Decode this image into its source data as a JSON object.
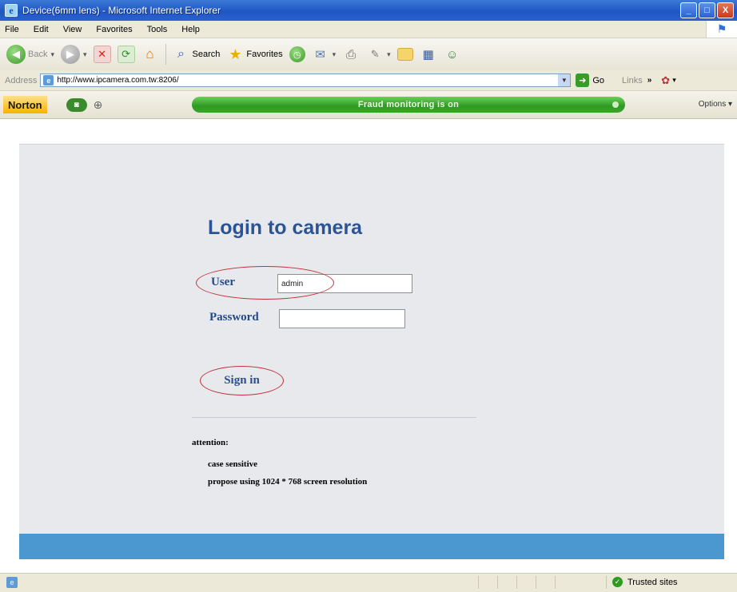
{
  "window": {
    "title": "Device(6mm lens) - Microsoft Internet Explorer",
    "minimize": "_",
    "maximize": "□",
    "close": "X"
  },
  "menu": [
    "File",
    "Edit",
    "View",
    "Favorites",
    "Tools",
    "Help"
  ],
  "toolbar": {
    "back": "Back",
    "search": "Search",
    "favorites": "Favorites"
  },
  "address": {
    "label": "Address",
    "url": "http://www.ipcamera.com.tw:8206/",
    "go": "Go",
    "links": "Links"
  },
  "norton": {
    "logo": "Norton",
    "status": "Fraud monitoring is on",
    "options": "Options ▾"
  },
  "login": {
    "title": "Login to camera",
    "user_label": "User",
    "user_value": "admin",
    "password_label": "Password",
    "password_value": "",
    "signin": "Sign in"
  },
  "notes": {
    "title": "attention:",
    "items": [
      "case sensitive",
      "propose using 1024 * 768 screen resolution"
    ]
  },
  "statusbar": {
    "zone": "Trusted sites"
  },
  "colors": {
    "title_blue": "#2b5494",
    "highlight_red": "#c0323a",
    "footer_blue": "#4b97cf",
    "panel_gray": "#e7e9ed",
    "norton_green": "#2f9a22"
  },
  "icons": {
    "back": "back-arrow-icon",
    "forward": "forward-arrow-icon",
    "stop": "stop-icon",
    "refresh": "refresh-icon",
    "home": "home-icon",
    "search": "search-icon",
    "favorites": "star-icon",
    "history": "history-icon",
    "mail": "mail-icon",
    "print": "print-icon",
    "edit": "edit-icon",
    "folder": "folder-icon",
    "research": "research-icon",
    "messenger": "messenger-icon"
  }
}
